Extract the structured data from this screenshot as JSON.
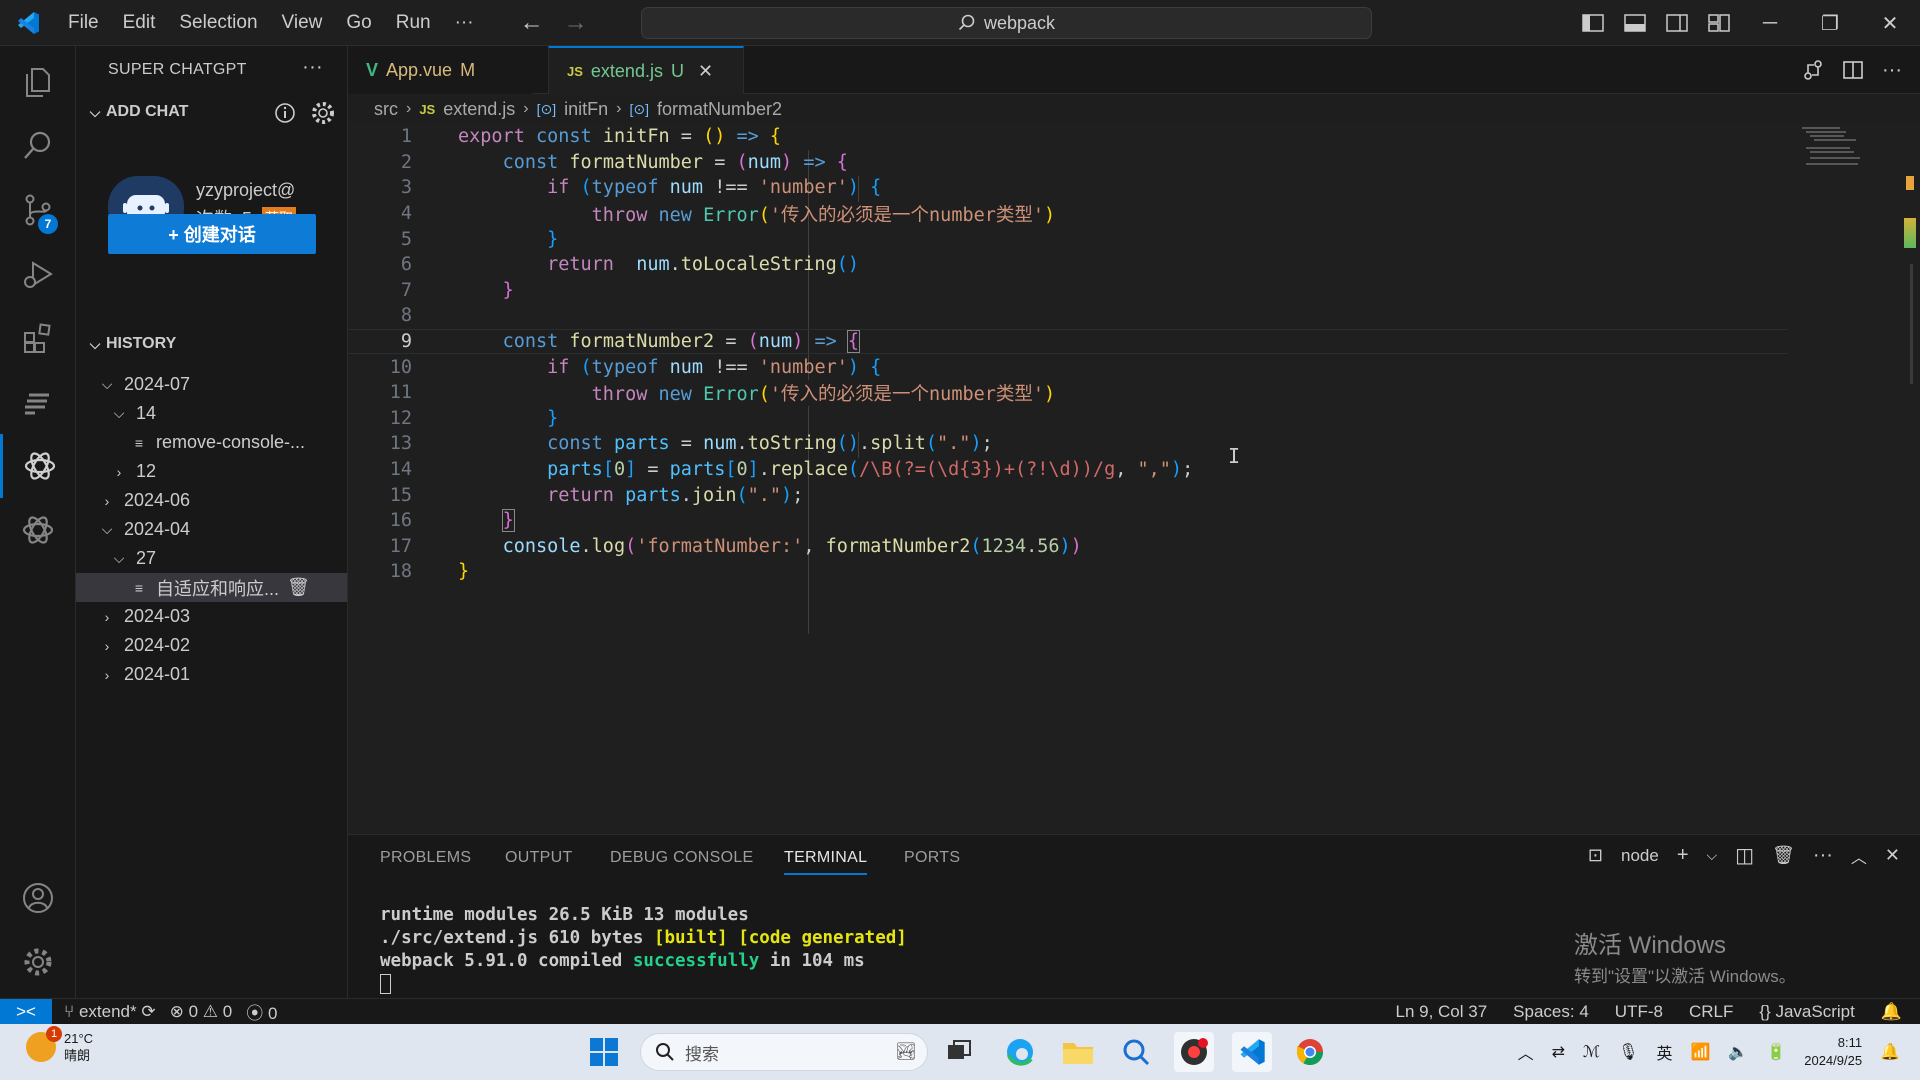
{
  "titlebar": {
    "menu": [
      "File",
      "Edit",
      "Selection",
      "View",
      "Go",
      "Run",
      "···"
    ],
    "search_text": "webpack"
  },
  "activity": {
    "scm_badge": "7"
  },
  "sidebar": {
    "title": "SUPER CHATGPT",
    "add_chat": "ADD CHAT",
    "user_name": "yzyproject@",
    "count_label": "次数: 5",
    "get_label": "获取",
    "create_button": "+ 创建对话",
    "history_title": "HISTORY",
    "history": [
      {
        "label": "2024-07"
      },
      {
        "label": "14"
      },
      {
        "label": "remove-console-..."
      },
      {
        "label": "12"
      },
      {
        "label": "2024-06"
      },
      {
        "label": "2024-04"
      },
      {
        "label": "27"
      },
      {
        "label": "自适应和响应..."
      },
      {
        "label": "2024-03"
      },
      {
        "label": "2024-02"
      },
      {
        "label": "2024-01"
      }
    ]
  },
  "tabs": [
    {
      "icon": "V",
      "name": "App.vue",
      "status": "M"
    },
    {
      "icon": "JS",
      "name": "extend.js",
      "status": "U"
    }
  ],
  "breadcrumb": {
    "folder": "src",
    "file": "extend.js",
    "sym1": "initFn",
    "sym2": "formatNumber2"
  },
  "editor": {
    "line_numbers": [
      "1",
      "2",
      "3",
      "4",
      "5",
      "6",
      "7",
      "8",
      "9",
      "10",
      "11",
      "12",
      "13",
      "14",
      "15",
      "16",
      "17",
      "18"
    ],
    "current_line": "9"
  },
  "panel": {
    "tabs": [
      "PROBLEMS",
      "OUTPUT",
      "DEBUG CONSOLE",
      "TERMINAL",
      "PORTS"
    ],
    "shell": "node",
    "terminal": {
      "l1": "runtime modules 26.5 KiB 13 modules",
      "l2a": "./src/extend.js 610 bytes ",
      "l2b": "[built] [code generated]",
      "l3a": "webpack 5.91.0 compiled ",
      "l3b": "successfully",
      "l3c": " in 104 ms"
    },
    "watermark1": "激活 Windows",
    "watermark2": "转到\"设置\"以激活 Windows。"
  },
  "status": {
    "branch": "extend*",
    "errors": "0",
    "warnings": "0",
    "ports": "0",
    "position": "Ln 9, Col 37",
    "spaces": "Spaces: 4",
    "encoding": "UTF-8",
    "eol": "CRLF",
    "language": "JavaScript"
  },
  "taskbar": {
    "temp": "21°C",
    "weather": "晴朗",
    "weather_badge": "1",
    "search_placeholder": "搜索",
    "ime": "英",
    "time": "8:11",
    "date": "2024/9/25"
  },
  "colors": {
    "accent": "#0078d4",
    "button": "#0e7bd6",
    "bg": "#1f1f1f"
  }
}
